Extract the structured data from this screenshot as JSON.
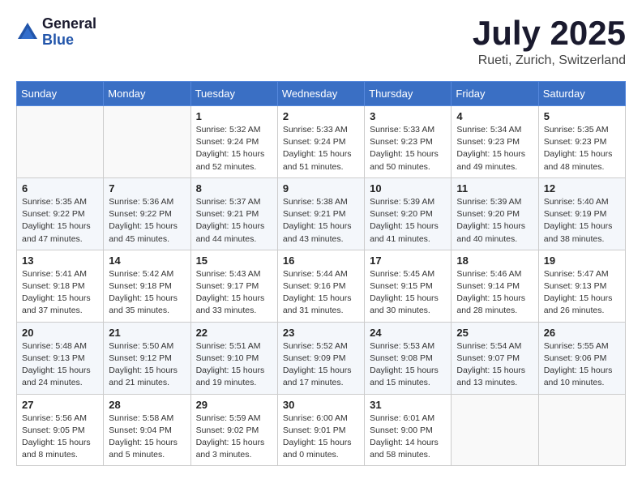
{
  "logo": {
    "general": "General",
    "blue": "Blue"
  },
  "title": {
    "month": "July 2025",
    "location": "Rueti, Zurich, Switzerland"
  },
  "weekdays": [
    "Sunday",
    "Monday",
    "Tuesday",
    "Wednesday",
    "Thursday",
    "Friday",
    "Saturday"
  ],
  "weeks": [
    [
      {
        "day": "",
        "info": ""
      },
      {
        "day": "",
        "info": ""
      },
      {
        "day": "1",
        "info": "Sunrise: 5:32 AM\nSunset: 9:24 PM\nDaylight: 15 hours\nand 52 minutes."
      },
      {
        "day": "2",
        "info": "Sunrise: 5:33 AM\nSunset: 9:24 PM\nDaylight: 15 hours\nand 51 minutes."
      },
      {
        "day": "3",
        "info": "Sunrise: 5:33 AM\nSunset: 9:23 PM\nDaylight: 15 hours\nand 50 minutes."
      },
      {
        "day": "4",
        "info": "Sunrise: 5:34 AM\nSunset: 9:23 PM\nDaylight: 15 hours\nand 49 minutes."
      },
      {
        "day": "5",
        "info": "Sunrise: 5:35 AM\nSunset: 9:23 PM\nDaylight: 15 hours\nand 48 minutes."
      }
    ],
    [
      {
        "day": "6",
        "info": "Sunrise: 5:35 AM\nSunset: 9:22 PM\nDaylight: 15 hours\nand 47 minutes."
      },
      {
        "day": "7",
        "info": "Sunrise: 5:36 AM\nSunset: 9:22 PM\nDaylight: 15 hours\nand 45 minutes."
      },
      {
        "day": "8",
        "info": "Sunrise: 5:37 AM\nSunset: 9:21 PM\nDaylight: 15 hours\nand 44 minutes."
      },
      {
        "day": "9",
        "info": "Sunrise: 5:38 AM\nSunset: 9:21 PM\nDaylight: 15 hours\nand 43 minutes."
      },
      {
        "day": "10",
        "info": "Sunrise: 5:39 AM\nSunset: 9:20 PM\nDaylight: 15 hours\nand 41 minutes."
      },
      {
        "day": "11",
        "info": "Sunrise: 5:39 AM\nSunset: 9:20 PM\nDaylight: 15 hours\nand 40 minutes."
      },
      {
        "day": "12",
        "info": "Sunrise: 5:40 AM\nSunset: 9:19 PM\nDaylight: 15 hours\nand 38 minutes."
      }
    ],
    [
      {
        "day": "13",
        "info": "Sunrise: 5:41 AM\nSunset: 9:18 PM\nDaylight: 15 hours\nand 37 minutes."
      },
      {
        "day": "14",
        "info": "Sunrise: 5:42 AM\nSunset: 9:18 PM\nDaylight: 15 hours\nand 35 minutes."
      },
      {
        "day": "15",
        "info": "Sunrise: 5:43 AM\nSunset: 9:17 PM\nDaylight: 15 hours\nand 33 minutes."
      },
      {
        "day": "16",
        "info": "Sunrise: 5:44 AM\nSunset: 9:16 PM\nDaylight: 15 hours\nand 31 minutes."
      },
      {
        "day": "17",
        "info": "Sunrise: 5:45 AM\nSunset: 9:15 PM\nDaylight: 15 hours\nand 30 minutes."
      },
      {
        "day": "18",
        "info": "Sunrise: 5:46 AM\nSunset: 9:14 PM\nDaylight: 15 hours\nand 28 minutes."
      },
      {
        "day": "19",
        "info": "Sunrise: 5:47 AM\nSunset: 9:13 PM\nDaylight: 15 hours\nand 26 minutes."
      }
    ],
    [
      {
        "day": "20",
        "info": "Sunrise: 5:48 AM\nSunset: 9:13 PM\nDaylight: 15 hours\nand 24 minutes."
      },
      {
        "day": "21",
        "info": "Sunrise: 5:50 AM\nSunset: 9:12 PM\nDaylight: 15 hours\nand 21 minutes."
      },
      {
        "day": "22",
        "info": "Sunrise: 5:51 AM\nSunset: 9:10 PM\nDaylight: 15 hours\nand 19 minutes."
      },
      {
        "day": "23",
        "info": "Sunrise: 5:52 AM\nSunset: 9:09 PM\nDaylight: 15 hours\nand 17 minutes."
      },
      {
        "day": "24",
        "info": "Sunrise: 5:53 AM\nSunset: 9:08 PM\nDaylight: 15 hours\nand 15 minutes."
      },
      {
        "day": "25",
        "info": "Sunrise: 5:54 AM\nSunset: 9:07 PM\nDaylight: 15 hours\nand 13 minutes."
      },
      {
        "day": "26",
        "info": "Sunrise: 5:55 AM\nSunset: 9:06 PM\nDaylight: 15 hours\nand 10 minutes."
      }
    ],
    [
      {
        "day": "27",
        "info": "Sunrise: 5:56 AM\nSunset: 9:05 PM\nDaylight: 15 hours\nand 8 minutes."
      },
      {
        "day": "28",
        "info": "Sunrise: 5:58 AM\nSunset: 9:04 PM\nDaylight: 15 hours\nand 5 minutes."
      },
      {
        "day": "29",
        "info": "Sunrise: 5:59 AM\nSunset: 9:02 PM\nDaylight: 15 hours\nand 3 minutes."
      },
      {
        "day": "30",
        "info": "Sunrise: 6:00 AM\nSunset: 9:01 PM\nDaylight: 15 hours\nand 0 minutes."
      },
      {
        "day": "31",
        "info": "Sunrise: 6:01 AM\nSunset: 9:00 PM\nDaylight: 14 hours\nand 58 minutes."
      },
      {
        "day": "",
        "info": ""
      },
      {
        "day": "",
        "info": ""
      }
    ]
  ]
}
